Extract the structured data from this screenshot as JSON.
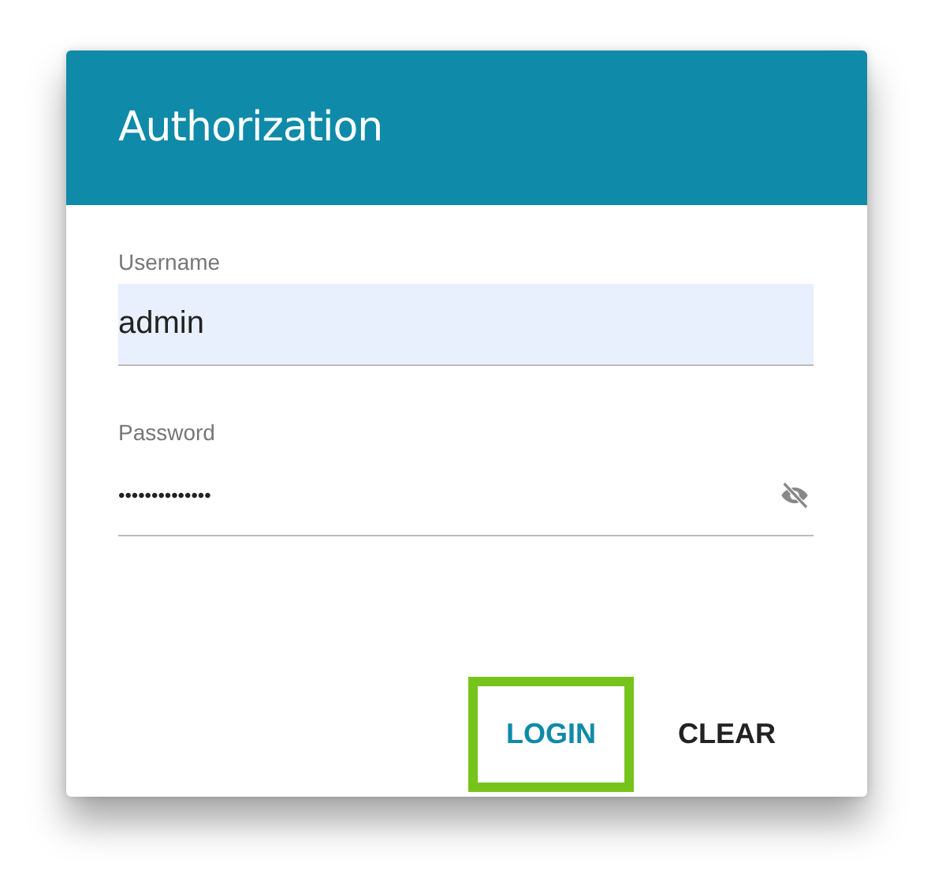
{
  "dialog": {
    "title": "Authorization"
  },
  "fields": [
    {
      "label": "Username",
      "value": "admin",
      "kind": "text",
      "autofilled": true
    },
    {
      "label": "Password",
      "value": "••••••••••••••",
      "kind": "password",
      "autofilled": false
    }
  ],
  "buttons": [
    {
      "label": "LOGIN",
      "primary": true,
      "highlighted": true
    },
    {
      "label": "CLEAR",
      "primary": false,
      "highlighted": false
    }
  ]
}
